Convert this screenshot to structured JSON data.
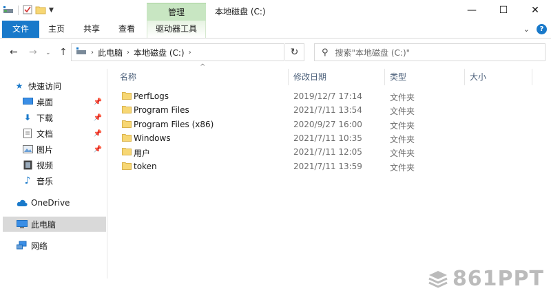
{
  "titlebar": {
    "context_tab": "管理",
    "title": "本地磁盘 (C:)",
    "minimize": "—",
    "maximize": "☐",
    "close": "✕"
  },
  "ribbon": {
    "tabs": [
      "文件",
      "主页",
      "共享",
      "查看",
      "驱动器工具"
    ],
    "help": "?"
  },
  "address": {
    "crumbs": [
      "此电脑",
      "本地磁盘 (C:)"
    ]
  },
  "search": {
    "placeholder": "搜索\"本地磁盘 (C:)\""
  },
  "sidebar": {
    "quick_access": "快速访问",
    "items": [
      "桌面",
      "下载",
      "文档",
      "图片",
      "视频",
      "音乐"
    ],
    "onedrive": "OneDrive",
    "this_pc": "此电脑",
    "network": "网络"
  },
  "columns": {
    "name": "名称",
    "date": "修改日期",
    "type": "类型",
    "size": "大小"
  },
  "files": [
    {
      "name": "PerfLogs",
      "date": "2019/12/7 17:14",
      "type": "文件夹"
    },
    {
      "name": "Program Files",
      "date": "2021/7/11 13:54",
      "type": "文件夹"
    },
    {
      "name": "Program Files (x86)",
      "date": "2020/9/27 16:00",
      "type": "文件夹"
    },
    {
      "name": "Windows",
      "date": "2021/7/11 10:35",
      "type": "文件夹"
    },
    {
      "name": "用户",
      "date": "2021/7/11 12:05",
      "type": "文件夹"
    },
    {
      "name": "token",
      "date": "2021/7/11 13:59",
      "type": "文件夹"
    }
  ],
  "watermark": "861PPT",
  "colors": {
    "accent": "#1979ca",
    "context_green": "#c8e6c2",
    "folder": "#f7d774"
  }
}
